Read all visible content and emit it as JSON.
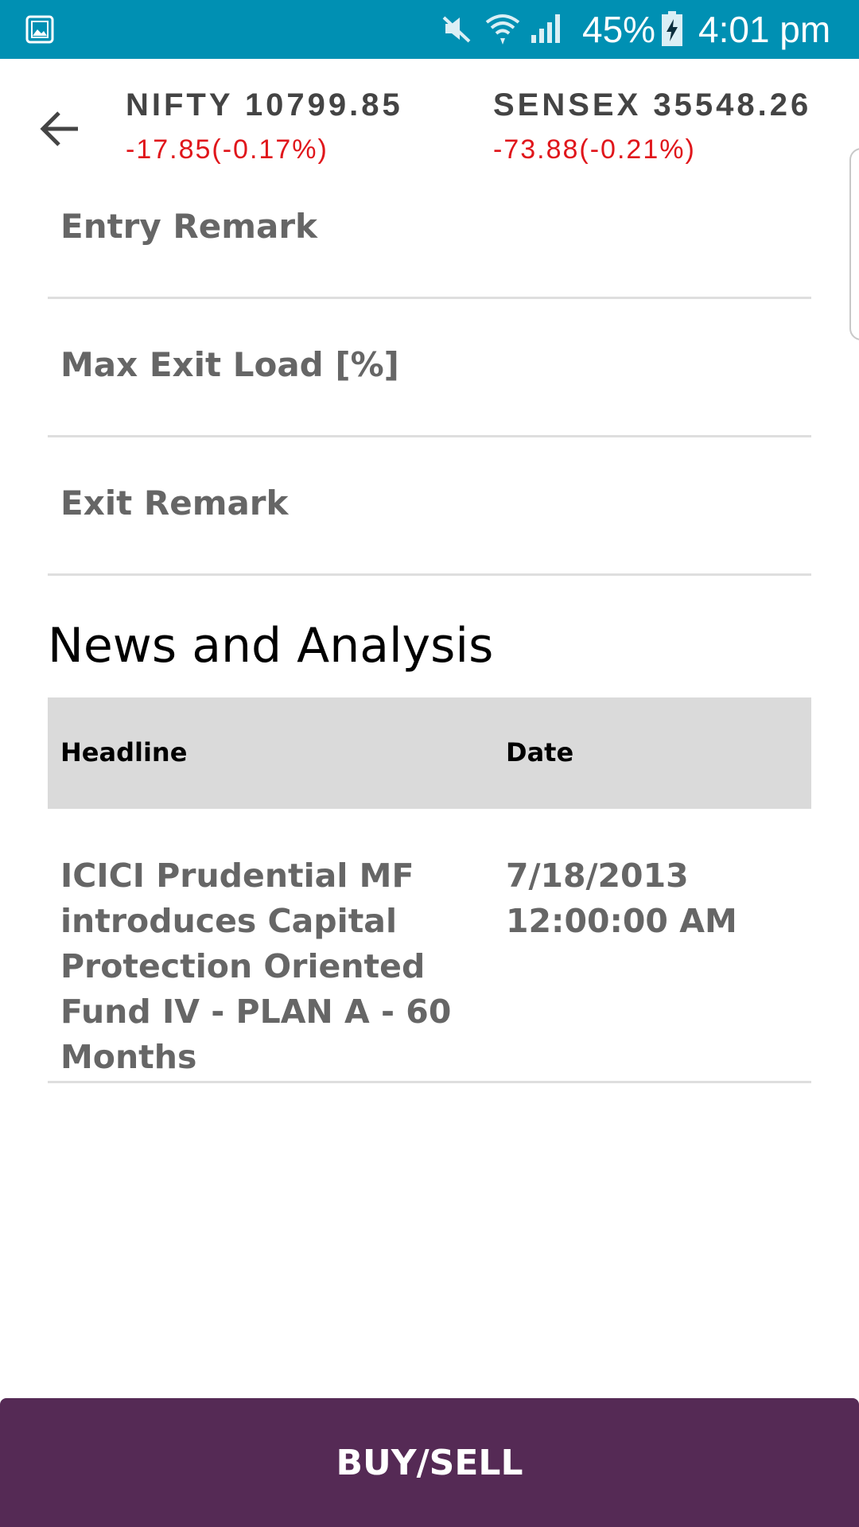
{
  "status_bar": {
    "battery_percent": "45%",
    "time": "4:01 pm",
    "icons": [
      "gallery-icon",
      "mute-icon",
      "wifi-icon",
      "signal-icon",
      "battery-charging-icon"
    ],
    "background_color": "#0090b3"
  },
  "header": {
    "back_icon": "back-arrow-icon",
    "tickers": [
      {
        "name": "NIFTY 10799.85",
        "change": "-17.85(-0.17%)"
      },
      {
        "name": "SENSEX 35548.26",
        "change": "-73.88(-0.21%)"
      }
    ],
    "change_color": "#e0161b"
  },
  "fields": [
    {
      "label": "Entry Remark"
    },
    {
      "label": "Max Exit Load [%]"
    },
    {
      "label": "Exit Remark"
    }
  ],
  "news": {
    "title": "News and Analysis",
    "columns": [
      "Headline",
      "Date"
    ],
    "rows": [
      {
        "headline": "ICICI Prudential MF introduces Capital Protection Oriented Fund IV - PLAN A - 60 Months",
        "date": "7/18/2013 12:00:00 AM"
      }
    ]
  },
  "action": {
    "label": "BUY/SELL",
    "color": "#552a55"
  }
}
